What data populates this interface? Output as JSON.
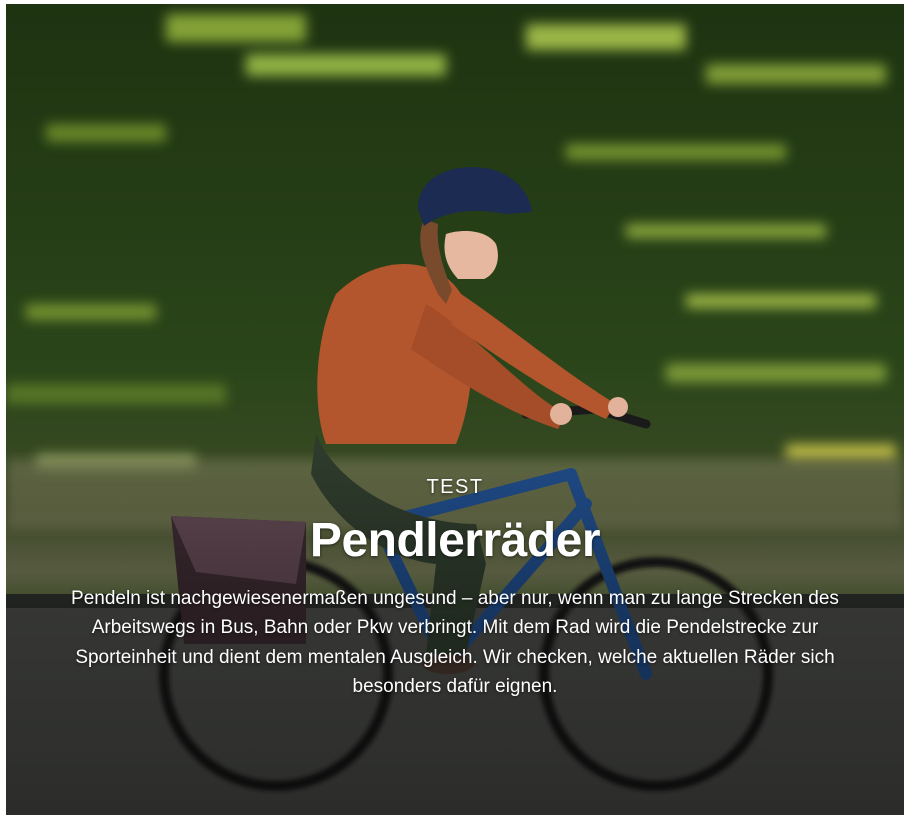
{
  "article": {
    "kicker": "TEST",
    "title": "Pendlerräder",
    "lead": "Pendeln ist nachgewiesenermaßen ungesund – aber nur, wenn man zu lange Strecken des Arbeitswegs in Bus, Bahn oder Pkw verbringt. Mit dem Rad wird die Pendelstrecke zur Sporteinheit und dient dem mentalen Ausgleich. Wir checken, welche aktuellen Räder sich besonders dafür eignen."
  },
  "colors": {
    "foliage": "#2f4a1c",
    "sweater": "#b4562d",
    "pants": "#2e3b2c",
    "bike_frame": "#1f4a86",
    "helmet": "#1b2b52"
  }
}
